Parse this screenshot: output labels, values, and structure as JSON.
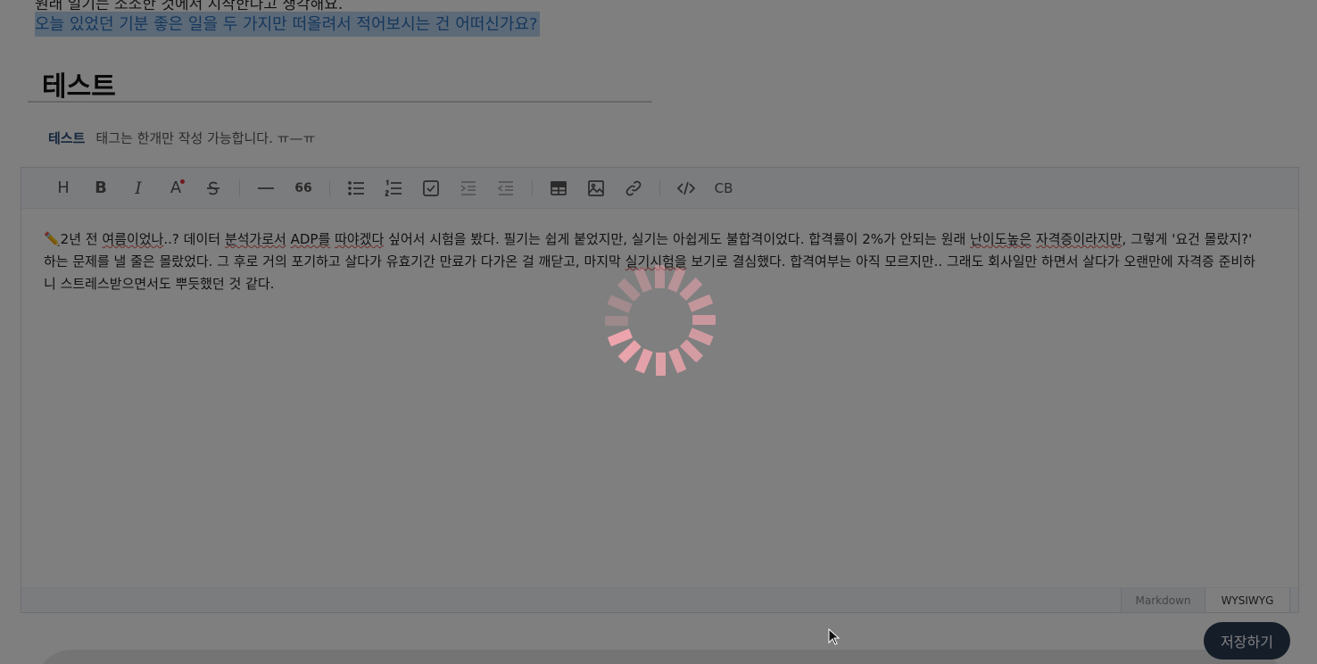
{
  "prompt": {
    "line1": "원래 일기는 소소한 것에서 시작한다고 생각해요.",
    "line2": "오늘 있었던 기분 좋은 일을 두 가지만 떠올려서 적어보시는 건 어떠신가요?"
  },
  "post": {
    "title": "테스트",
    "tag": "테스트",
    "tag_placeholder": "태그는 한개만 작성 가능합니다. ㅠ—ㅠ"
  },
  "toolbar": {
    "heading_label": "H",
    "bold_label": "B",
    "italic_label": "I",
    "font_color_label": "A",
    "quote_label": "66",
    "codeblock_label": "CB"
  },
  "editor": {
    "body_parts": [
      "✏️2년 전 ",
      "여름이었나",
      "..? 데이터 ",
      "분석가로서",
      " ",
      "ADP를",
      " ",
      "따야겠다",
      " 싶어서 시험을 봤다. 필기는 쉽게 붙었지만, 실기는 아쉽게도 불합격이었다. 합격률이 2%가 안되는 원래 ",
      "난이도높은",
      " ",
      "자격증이라지만",
      ", 그렇게 '요건 몰랐지?' 하는 문제를 낼 줄은 몰랐었다. 그 후로 거의 포기하고 살다가 유효기간 만료가 다가온 걸 깨닫고, 마지막 ",
      "실기시험을",
      " 보기로 결심했다. 합격여부는 아직 모르지만.. 그래도 회사일만 하면서 살다가 오랜만에 자격증 준비하니 스트레스받으면서도 뿌듯했던 것 같다."
    ]
  },
  "modes": {
    "markdown": "Markdown",
    "wysiwyg": "WYSIWYG"
  },
  "actions": {
    "save": "저장하기"
  },
  "colors": {
    "accent": "#2b3a53",
    "link": "#2a6fb8",
    "spinner": "#f4a7b0"
  }
}
